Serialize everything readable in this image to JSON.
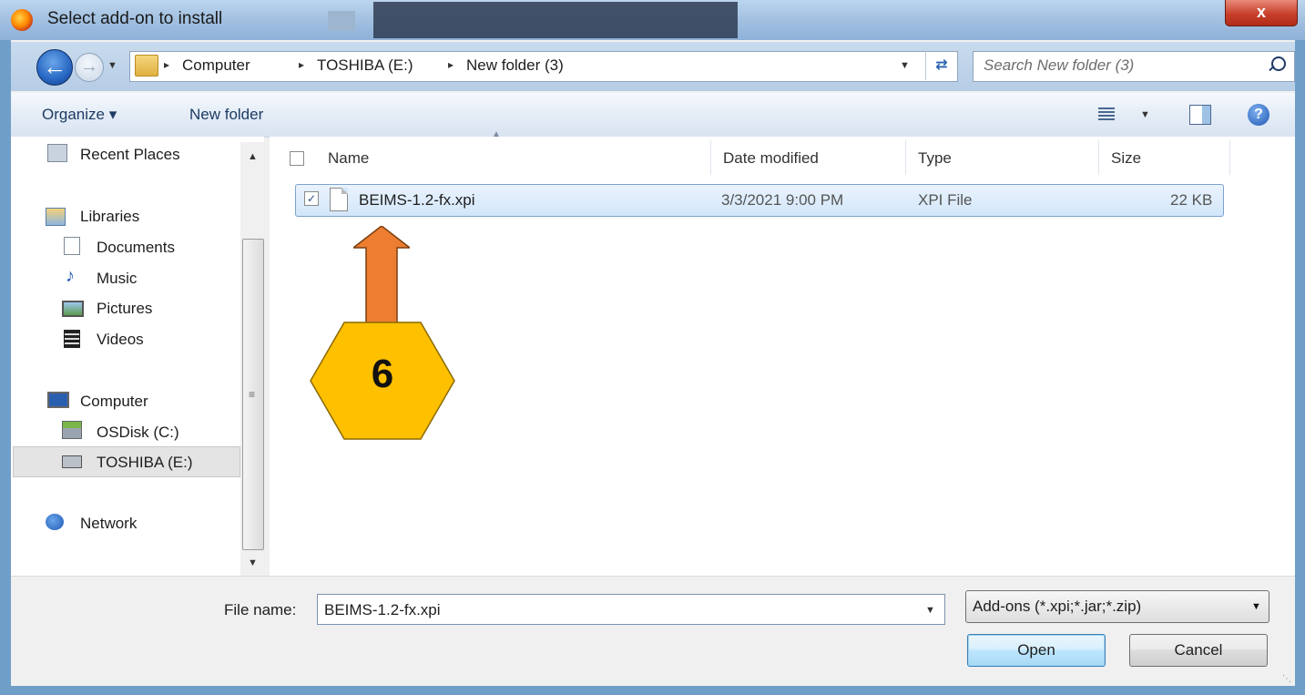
{
  "window": {
    "title": "Select add-on to install",
    "close_label": "x"
  },
  "address_bar": {
    "breadcrumbs": [
      "Computer",
      "TOSHIBA (E:)",
      "New folder (3)"
    ],
    "separator": "▸",
    "search_placeholder": "Search New folder (3)"
  },
  "toolbar": {
    "organize_label": "Organize ▾",
    "new_folder_label": "New folder",
    "help_label": "?"
  },
  "nav": {
    "items": [
      {
        "label": "Recent Places",
        "icon": "recent-places-icon"
      },
      {
        "label": "Libraries",
        "icon": "libraries-icon"
      },
      {
        "label": "Documents",
        "icon": "documents-icon"
      },
      {
        "label": "Music",
        "icon": "music-icon"
      },
      {
        "label": "Pictures",
        "icon": "pictures-icon"
      },
      {
        "label": "Videos",
        "icon": "videos-icon"
      },
      {
        "label": "Computer",
        "icon": "computer-icon"
      },
      {
        "label": "OSDisk (C:)",
        "icon": "drive-icon"
      },
      {
        "label": "TOSHIBA (E:)",
        "icon": "usb-drive-icon"
      },
      {
        "label": "Network",
        "icon": "network-icon"
      }
    ],
    "selected": "TOSHIBA (E:)"
  },
  "file_list": {
    "columns": [
      "Name",
      "Date modified",
      "Type",
      "Size"
    ],
    "rows": [
      {
        "name": "BEIMS-1.2-fx.xpi",
        "date_modified": "3/3/2021 9:00 PM",
        "type": "XPI File",
        "size": "22 KB",
        "checked": true,
        "selected": true
      }
    ]
  },
  "annotation": {
    "step_number": "6",
    "arrow_color": "#ed7d31",
    "badge_color": "#ffc000"
  },
  "bottom": {
    "file_name_label": "File name:",
    "file_name_value": "BEIMS-1.2-fx.xpi",
    "filter_value": "Add-ons (*.xpi;*.jar;*.zip)",
    "open_label": "Open",
    "cancel_label": "Cancel"
  }
}
